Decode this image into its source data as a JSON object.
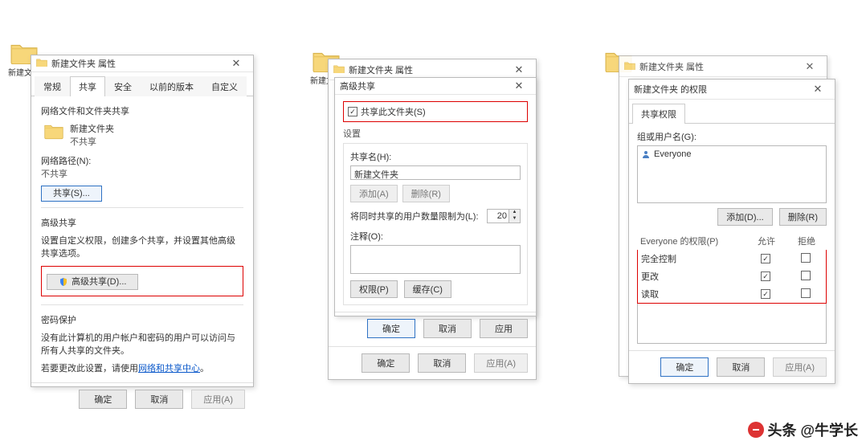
{
  "desktop": {
    "folder1_label": "新建文件",
    "folder2_label": "新建文件",
    "folder3_label": ""
  },
  "dialog1": {
    "title": "新建文件夹 属性",
    "tabs": {
      "general": "常规",
      "share": "共享",
      "security": "安全",
      "prev": "以前的版本",
      "custom": "自定义"
    },
    "sec_network": "网络文件和文件夹共享",
    "folder_name": "新建文件夹",
    "not_shared": "不共享",
    "netpath_label": "网络路径(N):",
    "netpath_value": "不共享",
    "share_btn": "共享(S)...",
    "sec_adv": "高级共享",
    "adv_desc": "设置自定义权限，创建多个共享，并设置其他高级共享选项。",
    "adv_btn": "高级共享(D)...",
    "sec_pw": "密码保护",
    "pw_line1": "没有此计算机的用户帐户和密码的用户可以访问与所有人共享的文件夹。",
    "pw_line2a": "若要更改此设置，请使用",
    "pw_link": "网络和共享中心",
    "pw_line2b": "。",
    "ok": "确定",
    "cancel": "取消",
    "apply": "应用(A)"
  },
  "dialog2_back": {
    "title": "新建文件夹 属性"
  },
  "dialog2": {
    "title": "高级共享",
    "share_this": "共享此文件夹(S)",
    "settings": "设置",
    "share_name_label": "共享名(H):",
    "share_name_value": "新建文件夹",
    "add": "添加(A)",
    "remove": "删除(R)",
    "limit_label": "将同时共享的用户数量限制为(L):",
    "limit_value": "20",
    "comment_label": "注释(O):",
    "perm_btn": "权限(P)",
    "cache_btn": "缓存(C)",
    "ok": "确定",
    "cancel": "取消",
    "apply": "应用"
  },
  "dialog2_hint": {
    "ok": "确定",
    "cancel": "取消",
    "apply": "应用(A)"
  },
  "dialog3_back": {
    "title": "新建文件夹 属性"
  },
  "dialog3": {
    "title": "新建文件夹 的权限",
    "tab": "共享权限",
    "group_label": "组或用户名(G):",
    "user": "Everyone",
    "add": "添加(D)...",
    "remove": "删除(R)",
    "perm_header": "Everyone 的权限(P)",
    "allow": "允许",
    "deny": "拒绝",
    "perm1": "完全控制",
    "perm2": "更改",
    "perm3": "读取",
    "ok": "确定",
    "cancel": "取消",
    "apply": "应用(A)"
  },
  "attribution": "头条 @牛学长"
}
